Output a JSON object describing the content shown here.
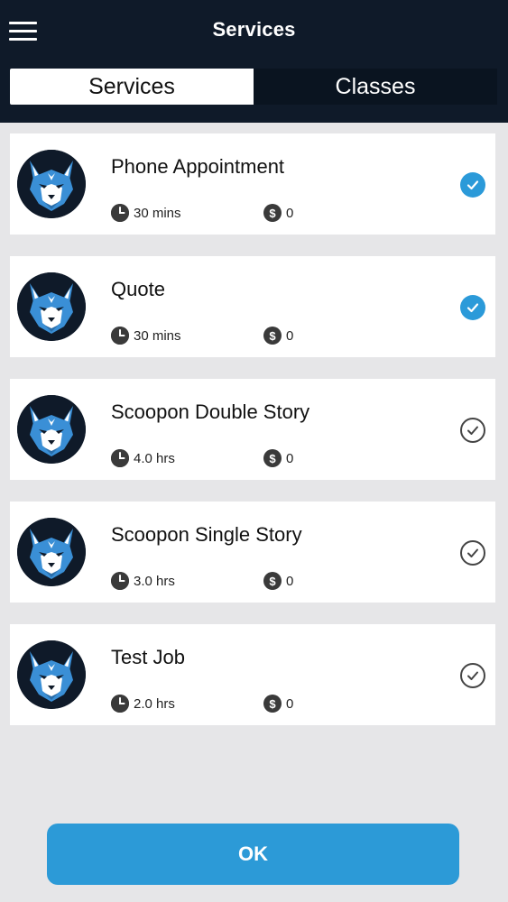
{
  "header": {
    "title": "Services",
    "menu_icon": "hamburger-menu-icon"
  },
  "tabs": [
    {
      "label": "Services",
      "active": true
    },
    {
      "label": "Classes",
      "active": false
    }
  ],
  "services": [
    {
      "name": "Phone Appointment",
      "duration": "30 mins",
      "price": "0",
      "selected": true
    },
    {
      "name": "Quote",
      "duration": "30 mins",
      "price": "0",
      "selected": true
    },
    {
      "name": "Scoopon Double Story",
      "duration": "4.0 hrs",
      "price": "0",
      "selected": false
    },
    {
      "name": "Scoopon Single Story",
      "duration": "3.0 hrs",
      "price": "0",
      "selected": false
    },
    {
      "name": "Test Job",
      "duration": "2.0 hrs",
      "price": "0",
      "selected": false
    }
  ],
  "icons": {
    "avatar": "wolf-logo-icon",
    "duration": "clock-icon",
    "price": "dollar-icon",
    "selected": "check-circle-filled-icon",
    "unselected": "check-circle-outline-icon"
  },
  "footer": {
    "ok_label": "OK"
  },
  "colors": {
    "header_bg": "#0f1a29",
    "accent": "#2c9ad7",
    "page_bg": "#e6e6e8"
  }
}
